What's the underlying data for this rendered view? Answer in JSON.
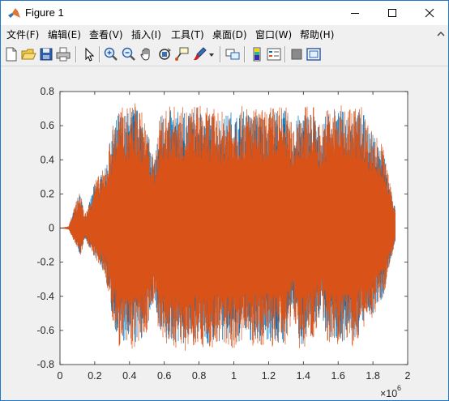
{
  "window": {
    "title": "Figure 1",
    "icon": "matlab-logo-icon"
  },
  "menu": {
    "items": [
      "文件(F)",
      "编辑(E)",
      "查看(V)",
      "插入(I)",
      "工具(T)",
      "桌面(D)",
      "窗口(W)",
      "帮助(H)"
    ]
  },
  "toolbar": {
    "icons": [
      "new-figure-icon",
      "open-file-icon",
      "save-icon",
      "print-icon",
      "pointer-icon",
      "zoom-in-icon",
      "zoom-out-icon",
      "pan-hand-icon",
      "rotate-3d-icon",
      "data-cursor-icon",
      "brush-icon",
      "brush-dropdown-icon",
      "link-plot-icon",
      "insert-colorbar-icon",
      "insert-legend-icon",
      "hide-plot-tools-icon",
      "show-plot-tools-icon"
    ]
  },
  "chart_data": {
    "type": "line",
    "title": "",
    "xlabel": "",
    "ylabel": "",
    "xlim": [
      0,
      2000000
    ],
    "ylim": [
      -0.8,
      0.8
    ],
    "xticks": [
      "0",
      "0.2",
      "0.4",
      "0.6",
      "0.8",
      "1",
      "1.2",
      "1.4",
      "1.6",
      "1.8",
      "2"
    ],
    "yticks": [
      "0.8",
      "0.6",
      "0.4",
      "0.2",
      "0",
      "-0.2",
      "-0.4",
      "-0.6",
      "-0.8"
    ],
    "x_exponent_label": "×10",
    "x_exponent_power": "6",
    "grid": false,
    "series": [
      {
        "color": "#0072bd",
        "description_of_extent": "audio waveform channel 1, mostly hidden beneath channel 2",
        "x_start": 0,
        "x_end": 1930000
      },
      {
        "color": "#d95319",
        "x_start": 0,
        "x_end": 1930000
      }
    ],
    "envelope": {
      "x": [
        0,
        50000,
        100000,
        120000,
        140000,
        160000,
        200000,
        260000,
        300000,
        340000,
        380000,
        420000,
        460000,
        500000,
        540000,
        580000,
        620000,
        660000,
        700000,
        740000,
        780000,
        820000,
        860000,
        900000,
        940000,
        980000,
        1020000,
        1060000,
        1100000,
        1140000,
        1180000,
        1220000,
        1260000,
        1300000,
        1340000,
        1380000,
        1420000,
        1460000,
        1500000,
        1540000,
        1580000,
        1620000,
        1660000,
        1700000,
        1740000,
        1780000,
        1820000,
        1860000,
        1900000,
        1930000
      ],
      "pos": [
        0.0,
        0.01,
        0.18,
        0.22,
        0.08,
        0.12,
        0.28,
        0.36,
        0.6,
        0.72,
        0.7,
        0.75,
        0.72,
        0.6,
        0.4,
        0.7,
        0.72,
        0.72,
        0.71,
        0.7,
        0.74,
        0.72,
        0.7,
        0.7,
        0.68,
        0.72,
        0.7,
        0.72,
        0.71,
        0.7,
        0.7,
        0.72,
        0.72,
        0.72,
        0.6,
        0.72,
        0.72,
        0.72,
        0.6,
        0.72,
        0.72,
        0.72,
        0.72,
        0.72,
        0.72,
        0.6,
        0.55,
        0.48,
        0.25,
        0.12
      ],
      "neg": [
        0.0,
        -0.01,
        -0.12,
        -0.18,
        -0.06,
        -0.1,
        -0.18,
        -0.28,
        -0.55,
        -0.7,
        -0.72,
        -0.72,
        -0.7,
        -0.62,
        -0.42,
        -0.72,
        -0.72,
        -0.7,
        -0.72,
        -0.72,
        -0.68,
        -0.7,
        -0.72,
        -0.7,
        -0.7,
        -0.7,
        -0.72,
        -0.65,
        -0.7,
        -0.72,
        -0.68,
        -0.7,
        -0.72,
        -0.7,
        -0.5,
        -0.72,
        -0.7,
        -0.65,
        -0.5,
        -0.7,
        -0.68,
        -0.7,
        -0.68,
        -0.72,
        -0.6,
        -0.55,
        -0.5,
        -0.42,
        -0.2,
        -0.08
      ]
    }
  }
}
